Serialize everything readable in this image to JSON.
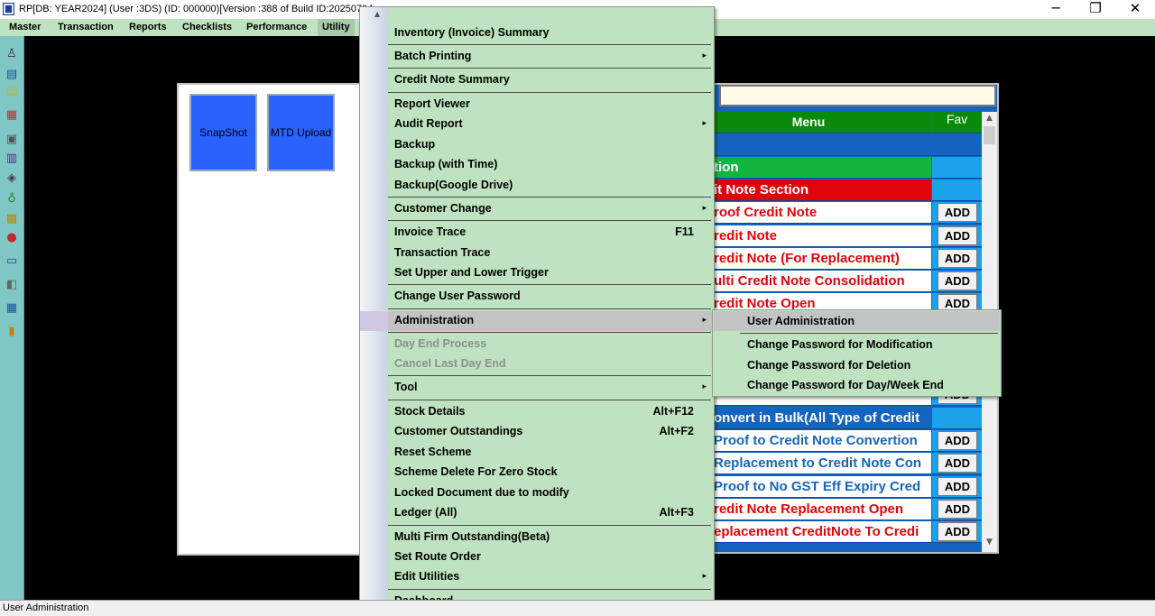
{
  "window": {
    "title": "RP[DB: YEAR2024] (User :3DS) (ID: 000000)[Version :388 of Build ID:20250704.",
    "minimize": "─",
    "maximize": "❐",
    "close": "✕"
  },
  "menubar": {
    "items": [
      {
        "label": "Master"
      },
      {
        "label": "Transaction"
      },
      {
        "label": "Reports"
      },
      {
        "label": "Checklists"
      },
      {
        "label": "Performance"
      },
      {
        "label": "Utility"
      }
    ]
  },
  "toolbar_left": {
    "icons": [
      "people-icon",
      "screen-icon",
      "smiley-icon",
      "calendar-icon",
      "card-icon",
      "lock-icon",
      "ribbon-icon",
      "flask-icon",
      "box-icon",
      "apple-icon",
      "window-icon",
      "stack-icon",
      "grid-icon",
      "exit-icon"
    ]
  },
  "snapshot_panel": {
    "tiles": [
      {
        "label": "SnapShot"
      },
      {
        "label": "MTD Upload"
      }
    ]
  },
  "menu_panel": {
    "header": {
      "menu": "Menu",
      "fav": "Fav"
    },
    "rows": [
      {
        "text": "",
        "bg": "#1565c0",
        "color": "#ffffff",
        "fav_bg": "#1565c0",
        "add": ""
      },
      {
        "text": "tion",
        "bg": "#14b441",
        "color": "#ffffff",
        "fav_bg": "#1aa3e8",
        "add": ""
      },
      {
        "text": "it Note Section",
        "bg": "#e0050b",
        "color": "#ffffff",
        "fav_bg": "#1aa3e8",
        "add": ""
      },
      {
        "text": "roof Credit Note",
        "bg": "#ffffff",
        "color": "#e0050b",
        "fav_bg": "#1aa3e8",
        "add": "ADD"
      },
      {
        "text": "redit Note",
        "bg": "#ffffff",
        "color": "#e0050b",
        "fav_bg": "#1aa3e8",
        "add": "ADD"
      },
      {
        "text": "redit Note (For Replacement)",
        "bg": "#ffffff",
        "color": "#e0050b",
        "fav_bg": "#1aa3e8",
        "add": "ADD"
      },
      {
        "text": "ulti Credit Note Consolidation",
        "bg": "#ffffff",
        "color": "#e0050b",
        "fav_bg": "#1aa3e8",
        "add": "ADD"
      },
      {
        "text": "redit Note Open",
        "bg": "#ffffff",
        "color": "#e0050b",
        "fav_bg": "#1aa3e8",
        "add": "ADD"
      },
      {
        "text": "",
        "bg": "#ffffff",
        "color": "#e0050b",
        "fav_bg": "#1aa3e8",
        "add": ""
      },
      {
        "text": "",
        "bg": "#ffffff",
        "color": "#e0050b",
        "fav_bg": "#1aa3e8",
        "add": ""
      },
      {
        "text": "",
        "bg": "#ffffff",
        "color": "#e0050b",
        "fav_bg": "#1aa3e8",
        "add": ""
      },
      {
        "text": "",
        "bg": "#ffffff",
        "color": "#e0050b",
        "fav_bg": "#1aa3e8",
        "add": "ADD"
      },
      {
        "text": "onvert in Bulk(All Type of Credit",
        "bg": "#1565c0",
        "color": "#ffffff",
        "fav_bg": "#1aa3e8",
        "add": ""
      },
      {
        "text": "Proof to Credit Note Convertion",
        "bg": "#ffffff",
        "color": "#1565c0",
        "fav_bg": "#1aa3e8",
        "add": "ADD"
      },
      {
        "text": "Replacement to Credit Note Con",
        "bg": "#ffffff",
        "color": "#1565c0",
        "fav_bg": "#1aa3e8",
        "add": "ADD"
      },
      {
        "text": "Proof to No GST Eff Expiry Cred",
        "bg": "#ffffff",
        "color": "#1565c0",
        "fav_bg": "#1aa3e8",
        "add": "ADD"
      },
      {
        "text": "redit Note Replacement Open",
        "bg": "#ffffff",
        "color": "#e0050b",
        "fav_bg": "#1aa3e8",
        "add": "ADD"
      },
      {
        "text": "eplacement CreditNote To Credi",
        "bg": "#ffffff",
        "color": "#e0050b",
        "fav_bg": "#1aa3e8",
        "add": "ADD"
      }
    ]
  },
  "dropdown": {
    "items": [
      {
        "label": "Inventory (Invoice) Summary",
        "shortcut": "",
        "arrow": "",
        "sep_before": false
      },
      {
        "label": "Batch Printing",
        "shortcut": "",
        "arrow": "▸",
        "sep_before": true
      },
      {
        "label": "Credit Note Summary",
        "shortcut": "",
        "arrow": "",
        "sep_before": true
      },
      {
        "label": "Report Viewer",
        "shortcut": "",
        "arrow": "",
        "sep_before": true
      },
      {
        "label": "Audit Report",
        "shortcut": "",
        "arrow": "▸",
        "sep_before": false
      },
      {
        "label": "Backup",
        "shortcut": "",
        "arrow": "",
        "sep_before": false
      },
      {
        "label": "Backup (with Time)",
        "shortcut": "",
        "arrow": "",
        "sep_before": false
      },
      {
        "label": "Backup(Google Drive)",
        "shortcut": "",
        "arrow": "",
        "sep_before": false
      },
      {
        "label": "Customer Change",
        "shortcut": "",
        "arrow": "▸",
        "sep_before": true
      },
      {
        "label": "Invoice Trace",
        "shortcut": "F11",
        "arrow": "",
        "sep_before": true
      },
      {
        "label": "Transaction Trace",
        "shortcut": "",
        "arrow": "",
        "sep_before": false
      },
      {
        "label": "Set Upper and Lower Trigger",
        "shortcut": "",
        "arrow": "",
        "sep_before": false
      },
      {
        "label": "Change User Password",
        "shortcut": "",
        "arrow": "",
        "sep_before": true
      },
      {
        "label": "Administration",
        "shortcut": "",
        "arrow": "▸",
        "sep_before": true
      },
      {
        "label": "Day End Process",
        "shortcut": "",
        "arrow": "",
        "sep_before": true
      },
      {
        "label": "Cancel Last Day End",
        "shortcut": "",
        "arrow": "",
        "sep_before": false
      },
      {
        "label": "Tool",
        "shortcut": "",
        "arrow": "▸",
        "sep_before": true
      },
      {
        "label": "Stock Details",
        "shortcut": "Alt+F12",
        "arrow": "",
        "sep_before": true
      },
      {
        "label": "Customer Outstandings",
        "shortcut": "Alt+F2",
        "arrow": "",
        "sep_before": false
      },
      {
        "label": "Reset Scheme",
        "shortcut": "",
        "arrow": "",
        "sep_before": false
      },
      {
        "label": "Scheme Delete For Zero Stock",
        "shortcut": "",
        "arrow": "",
        "sep_before": false
      },
      {
        "label": "Locked Document due to modify",
        "shortcut": "",
        "arrow": "",
        "sep_before": false
      },
      {
        "label": "Ledger (All)",
        "shortcut": "Alt+F3",
        "arrow": "",
        "sep_before": false
      },
      {
        "label": "Multi Firm Outstanding(Beta)",
        "shortcut": "",
        "arrow": "",
        "sep_before": true
      },
      {
        "label": "Set Route Order",
        "shortcut": "",
        "arrow": "",
        "sep_before": false
      },
      {
        "label": "Edit Utilities",
        "shortcut": "",
        "arrow": "▸",
        "sep_before": false
      },
      {
        "label": "Dashboard",
        "shortcut": "",
        "arrow": "",
        "sep_before": true
      }
    ],
    "scroll_up": "▲"
  },
  "submenu": {
    "items": [
      {
        "label": "User Administration"
      },
      {
        "label": "Change Password for Modification"
      },
      {
        "label": "Change Password for Deletion"
      },
      {
        "label": "Change Password for Day/Week End"
      }
    ]
  },
  "statusbar": {
    "text": "User Administration"
  }
}
